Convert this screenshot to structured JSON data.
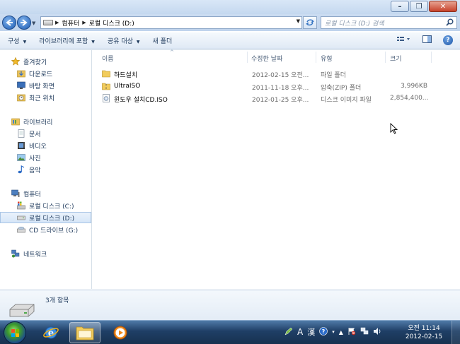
{
  "window": {
    "min_glyph": "–",
    "max_glyph": "❐",
    "close_glyph": "✕"
  },
  "address": {
    "crumbs": [
      "컴퓨터",
      "로컬 디스크 (D:)"
    ],
    "search_placeholder": "로컬 디스크 (D:) 검색"
  },
  "toolbar": {
    "items": [
      "구성",
      "라이브러리에 포함",
      "공유 대상",
      "새 폴더"
    ]
  },
  "nav": {
    "favorites": "즐겨찾기",
    "downloads": "다운로드",
    "desktop": "바탕 화면",
    "recent": "최근 위치",
    "libraries": "라이브러리",
    "documents": "문서",
    "videos": "비디오",
    "pictures": "사진",
    "music": "음악",
    "computer": "컴퓨터",
    "drive_c": "로컬 디스크 (C:)",
    "drive_d": "로컬 디스크 (D:)",
    "drive_g": "CD 드라이브 (G:)",
    "network": "네트워크"
  },
  "columns": {
    "name": "이름",
    "date": "수정한 날짜",
    "type": "유형",
    "size": "크기"
  },
  "files": [
    {
      "name": "하드설치",
      "date": "2012-02-15 오전...",
      "type": "파일 폴더",
      "size": "",
      "icon": "folder-icon"
    },
    {
      "name": "UltraISO",
      "date": "2011-11-18 오후...",
      "type": "압축(ZIP) 폴더",
      "size": "3,996KB",
      "icon": "zip-folder-icon"
    },
    {
      "name": "윈도우 설치CD.ISO",
      "date": "2012-01-25 오후...",
      "type": "디스크 이미지 파일",
      "size": "2,854,400...",
      "icon": "disc-image-icon"
    }
  ],
  "details": {
    "count": "3개 항목"
  },
  "taskbar": {
    "tray_lang": "A",
    "tray_hanja": "漢",
    "time": "오전 11:14",
    "date": "2012-02-15"
  },
  "colors": {
    "accent": "#1e395b",
    "selection": "#d6e6f8"
  }
}
